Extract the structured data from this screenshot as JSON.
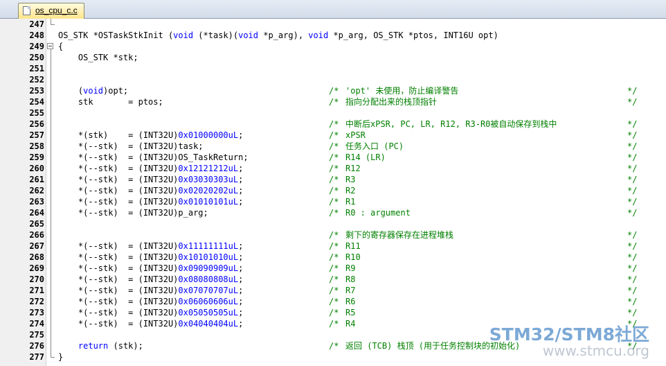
{
  "tab": {
    "label": "os_cpu_c.c"
  },
  "lines": [
    {
      "num": "247",
      "code": [],
      "comment": null
    },
    {
      "num": "248",
      "code": [
        [
          "",
          "OS_STK *OSTaskStkInit ("
        ],
        [
          "kw",
          "void"
        ],
        [
          "",
          " (*task)("
        ],
        [
          "kw",
          "void"
        ],
        [
          "",
          " *p_arg), "
        ],
        [
          "kw",
          "void"
        ],
        [
          "",
          " *p_arg, OS_STK *ptos, INT16U opt)"
        ]
      ],
      "comment": null
    },
    {
      "num": "249",
      "code": [
        [
          "",
          "{"
        ]
      ],
      "comment": null
    },
    {
      "num": "250",
      "code": [
        [
          "",
          "    OS_STK *stk;"
        ]
      ],
      "comment": null
    },
    {
      "num": "251",
      "code": [],
      "comment": null
    },
    {
      "num": "252",
      "code": [],
      "comment": null
    },
    {
      "num": "253",
      "code": [
        [
          "",
          "    ("
        ],
        [
          "kw",
          "void"
        ],
        [
          "",
          ")opt;"
        ]
      ],
      "comment": "'opt' 未使用，防止编译警告"
    },
    {
      "num": "254",
      "code": [
        [
          "",
          "    stk       = ptos;"
        ]
      ],
      "comment": "指向分配出来的栈顶指针"
    },
    {
      "num": "255",
      "code": [],
      "comment": null
    },
    {
      "num": "256",
      "code": [],
      "comment": "中断后xPSR, PC, LR, R12, R3-R0被自动保存到栈中"
    },
    {
      "num": "257",
      "code": [
        [
          "",
          "    *(stk)    = (INT32U)"
        ],
        [
          "num",
          "0x01000000uL"
        ],
        [
          "",
          ";"
        ]
      ],
      "comment": "xPSR"
    },
    {
      "num": "258",
      "code": [
        [
          "",
          "    *(--stk)  = (INT32U)task;"
        ]
      ],
      "comment": "任务入口 (PC)"
    },
    {
      "num": "259",
      "code": [
        [
          "",
          "    *(--stk)  = (INT32U)OS_TaskReturn;"
        ]
      ],
      "comment": "R14 (LR)"
    },
    {
      "num": "260",
      "code": [
        [
          "",
          "    *(--stk)  = (INT32U)"
        ],
        [
          "num",
          "0x12121212uL"
        ],
        [
          "",
          ";"
        ]
      ],
      "comment": "R12"
    },
    {
      "num": "261",
      "code": [
        [
          "",
          "    *(--stk)  = (INT32U)"
        ],
        [
          "num",
          "0x03030303uL"
        ],
        [
          "",
          ";"
        ]
      ],
      "comment": "R3"
    },
    {
      "num": "262",
      "code": [
        [
          "",
          "    *(--stk)  = (INT32U)"
        ],
        [
          "num",
          "0x02020202uL"
        ],
        [
          "",
          ";"
        ]
      ],
      "comment": "R2"
    },
    {
      "num": "263",
      "code": [
        [
          "",
          "    *(--stk)  = (INT32U)"
        ],
        [
          "num",
          "0x01010101uL"
        ],
        [
          "",
          ";"
        ]
      ],
      "comment": "R1"
    },
    {
      "num": "264",
      "code": [
        [
          "",
          "    *(--stk)  = (INT32U)p_arg;"
        ]
      ],
      "comment": "R0 : argument"
    },
    {
      "num": "265",
      "code": [],
      "comment": null
    },
    {
      "num": "266",
      "code": [],
      "comment": "剩下的寄存器保存在进程堆栈"
    },
    {
      "num": "267",
      "code": [
        [
          "",
          "    *(--stk)  = (INT32U)"
        ],
        [
          "num",
          "0x11111111uL"
        ],
        [
          "",
          ";"
        ]
      ],
      "comment": "R11"
    },
    {
      "num": "268",
      "code": [
        [
          "",
          "    *(--stk)  = (INT32U)"
        ],
        [
          "num",
          "0x10101010uL"
        ],
        [
          "",
          ";"
        ]
      ],
      "comment": "R10"
    },
    {
      "num": "269",
      "code": [
        [
          "",
          "    *(--stk)  = (INT32U)"
        ],
        [
          "num",
          "0x09090909uL"
        ],
        [
          "",
          ";"
        ]
      ],
      "comment": "R9"
    },
    {
      "num": "270",
      "code": [
        [
          "",
          "    *(--stk)  = (INT32U)"
        ],
        [
          "num",
          "0x08080808uL"
        ],
        [
          "",
          ";"
        ]
      ],
      "comment": "R8"
    },
    {
      "num": "271",
      "code": [
        [
          "",
          "    *(--stk)  = (INT32U)"
        ],
        [
          "num",
          "0x07070707uL"
        ],
        [
          "",
          ";"
        ]
      ],
      "comment": "R7"
    },
    {
      "num": "272",
      "code": [
        [
          "",
          "    *(--stk)  = (INT32U)"
        ],
        [
          "num",
          "0x06060606uL"
        ],
        [
          "",
          ";"
        ]
      ],
      "comment": "R6"
    },
    {
      "num": "273",
      "code": [
        [
          "",
          "    *(--stk)  = (INT32U)"
        ],
        [
          "num",
          "0x05050505uL"
        ],
        [
          "",
          ";"
        ]
      ],
      "comment": "R5"
    },
    {
      "num": "274",
      "code": [
        [
          "",
          "    *(--stk)  = (INT32U)"
        ],
        [
          "num",
          "0x04040404uL"
        ],
        [
          "",
          ";"
        ]
      ],
      "comment": "R4"
    },
    {
      "num": "275",
      "code": [],
      "comment": null
    },
    {
      "num": "276",
      "code": [
        [
          "",
          "    "
        ],
        [
          "kw",
          "return"
        ],
        [
          "",
          " (stk);"
        ]
      ],
      "comment": "返回 (TCB) 栈顶 (用于任务控制块的初始化)"
    },
    {
      "num": "277",
      "code": [
        [
          "",
          "}"
        ]
      ],
      "comment": null
    }
  ],
  "comment_delims": {
    "open": "/*",
    "close": "*/"
  },
  "watermark": {
    "title": "STM32/STM8社区",
    "url": "www.stmcu.org"
  },
  "colors": {
    "keyword": "#0000ff",
    "comment": "#008000",
    "text": "#000000",
    "tab_active": "#ffe58c"
  }
}
